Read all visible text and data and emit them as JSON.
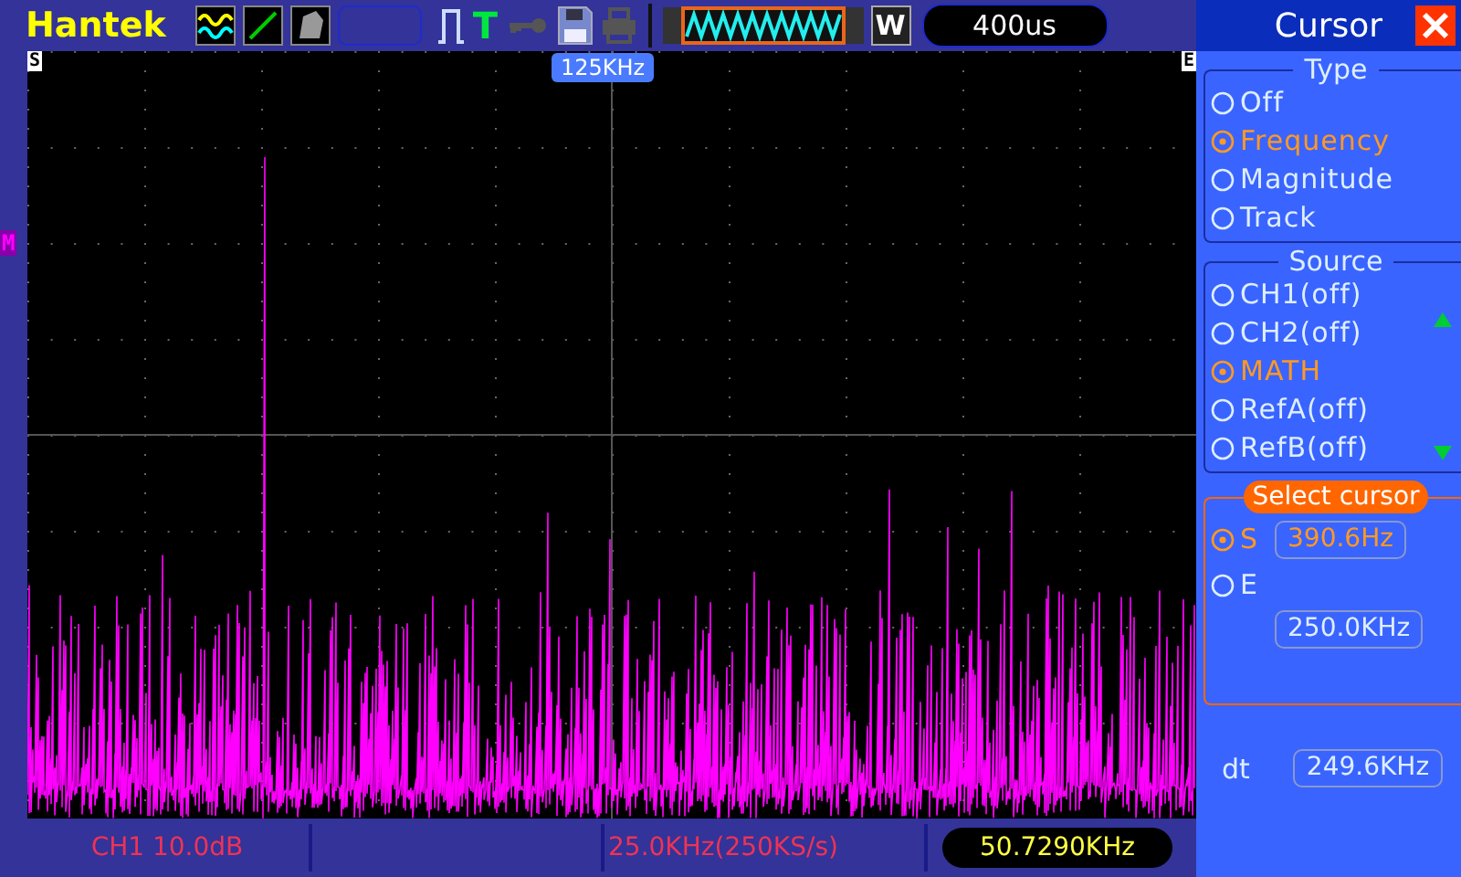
{
  "header": {
    "brand": "Hantek",
    "trigger": "T",
    "window_button": "W",
    "timebase": "400us"
  },
  "plot": {
    "center_marker": "125KHz",
    "start_marker": "S",
    "end_marker": "E",
    "math_marker": "M"
  },
  "panel": {
    "title": "Cursor",
    "type_group": {
      "title": "Type",
      "options": [
        {
          "label": "Off",
          "selected": false
        },
        {
          "label": "Frequency",
          "selected": true
        },
        {
          "label": "Magnitude",
          "selected": false
        },
        {
          "label": "Track",
          "selected": false
        }
      ]
    },
    "source_group": {
      "title": "Source",
      "options": [
        {
          "label": "CH1(off)",
          "selected": false
        },
        {
          "label": "CH2(off)",
          "selected": false
        },
        {
          "label": "MATH",
          "selected": true
        },
        {
          "label": "RefA(off)",
          "selected": false
        },
        {
          "label": "RefB(off)",
          "selected": false
        }
      ]
    },
    "select_cursor": {
      "title": "Select cursor",
      "cursors": [
        {
          "label": "S",
          "value": "390.6Hz",
          "selected": true
        },
        {
          "label": "E",
          "value": "250.0KHz",
          "selected": false
        }
      ]
    },
    "dt": {
      "label": "dt",
      "value": "249.6KHz"
    }
  },
  "status_bar": {
    "channel": "CH1 10.0dB",
    "sample_rate": "25.0KHz(250KS/s)",
    "frequency": "50.7290KHz"
  }
}
